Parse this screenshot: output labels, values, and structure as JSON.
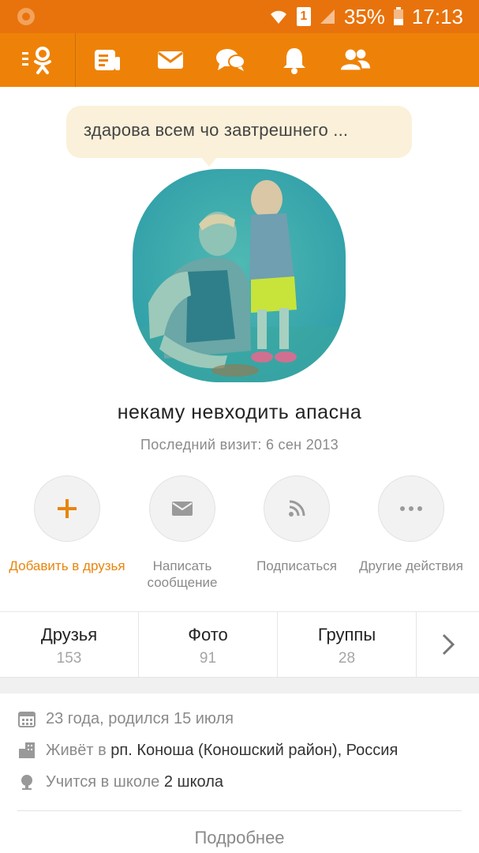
{
  "status_bar": {
    "battery": "35%",
    "time": "17:13",
    "sim": "1"
  },
  "nav": {
    "icons": [
      "ok-logo-icon",
      "feed-icon",
      "mail-icon",
      "chat-icon",
      "bell-icon",
      "friends-icon"
    ]
  },
  "colors": {
    "accent": "#ee8208",
    "status_bar": "#e8730c",
    "bubble": "#fbf0d9"
  },
  "profile": {
    "status_text": "здарова всем чо завтрешнего ...",
    "name": "некаму невходить апасна",
    "last_visit": "Последний визит: 6 сен 2013"
  },
  "actions": [
    {
      "label": "Добавить в друзья",
      "icon": "plus-icon"
    },
    {
      "label": "Написать сообщение",
      "icon": "envelope-icon"
    },
    {
      "label": "Подписаться",
      "icon": "rss-icon"
    },
    {
      "label": "Другие действия",
      "icon": "more-dots-icon"
    }
  ],
  "tabs": [
    {
      "label": "Друзья",
      "count": "153"
    },
    {
      "label": "Фото",
      "count": "91"
    },
    {
      "label": "Группы",
      "count": "28"
    }
  ],
  "info": {
    "age": "23 года, родился 15 июля",
    "lives_prefix": "Живёт в",
    "lives_place": "рп. Коноша (Коношский район), Россия",
    "study_prefix": "Учится в школе",
    "study_place": "2 школа"
  },
  "more_link": "Подробнее"
}
